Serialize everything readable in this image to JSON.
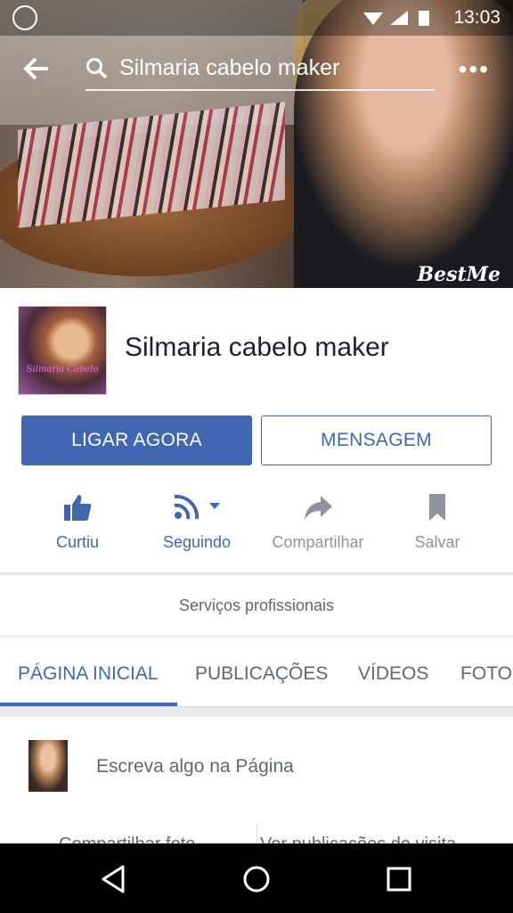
{
  "status_bar": {
    "time": "13:03"
  },
  "search": {
    "query": "Silmaria cabelo maker"
  },
  "cover": {
    "watermark": "BestMe"
  },
  "page": {
    "name": "Silmaria cabelo maker",
    "profile_pic_caption": "Silmaria Cabelo"
  },
  "buttons": {
    "call": "LIGAR AGORA",
    "message": "MENSAGEM"
  },
  "actions": [
    {
      "label": "Curtiu",
      "icon": "thumbs-up-icon"
    },
    {
      "label": "Seguindo",
      "icon": "rss-icon"
    },
    {
      "label": "Compartilhar",
      "icon": "share-icon"
    },
    {
      "label": "Salvar",
      "icon": "bookmark-icon"
    }
  ],
  "category": "Serviços profissionais",
  "tabs": [
    "PÁGINA INICIAL",
    "PUBLICAÇÕES",
    "VÍDEOS",
    "FOTOS"
  ],
  "composer": {
    "prompt": "Escreva algo na Página"
  },
  "links": {
    "share_photo": "Compartilhar foto",
    "visitor_posts": "Ver publicações de visita"
  },
  "colors": {
    "accent": "#4267b2",
    "muted": "#606770",
    "active_icon": "#4267b2",
    "inactive_icon": "#8d949e"
  }
}
